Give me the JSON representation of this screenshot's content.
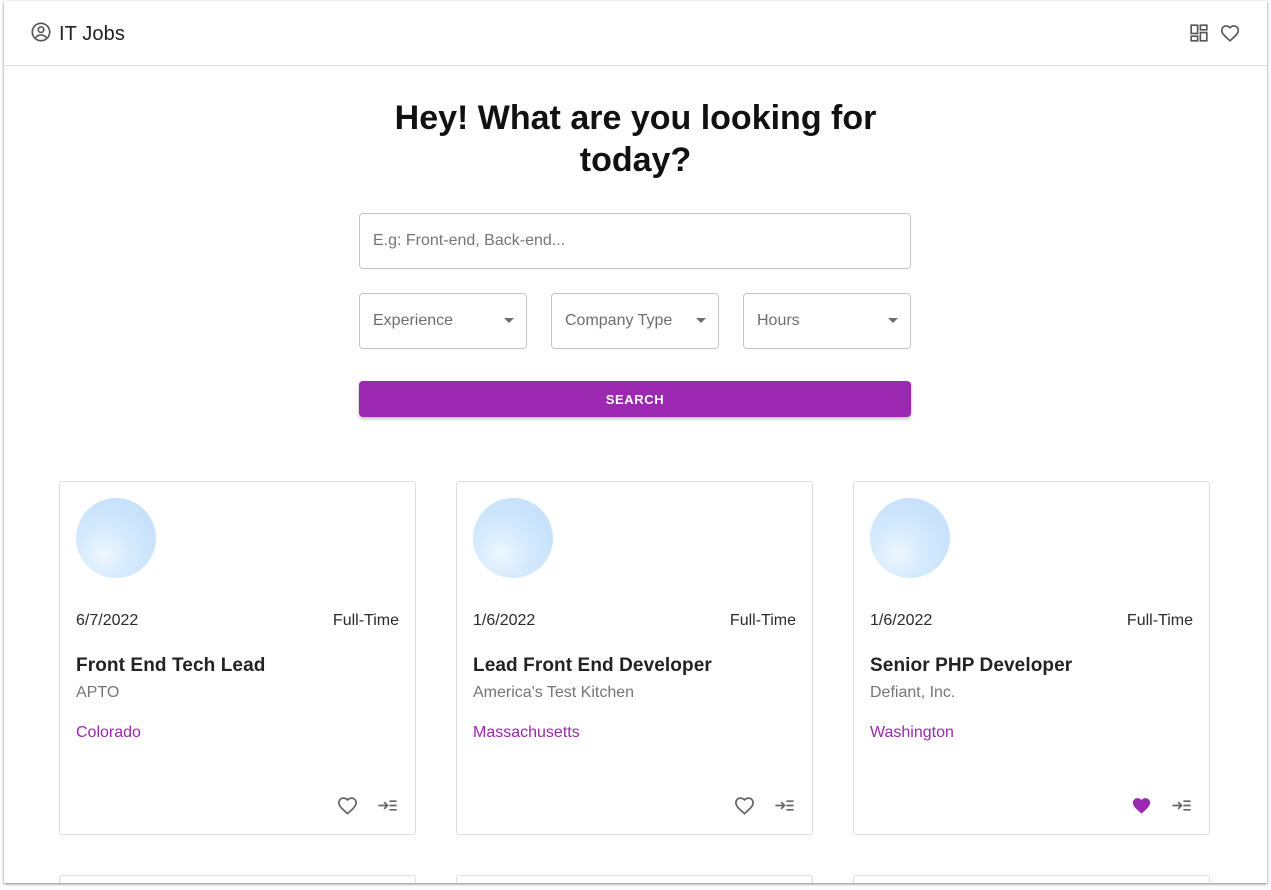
{
  "header": {
    "brand_icon": "account-circle-icon",
    "title": "IT Jobs",
    "actions": [
      {
        "name": "dashboard-icon"
      },
      {
        "name": "favorites-heart-icon"
      }
    ]
  },
  "hero": {
    "title_line1": "Hey! What are you looking for",
    "title_line2": "today?"
  },
  "search": {
    "placeholder": "E.g: Front-end, Back-end...",
    "value": ""
  },
  "filters": {
    "experience": "Experience",
    "company_type": "Company Type",
    "hours": "Hours"
  },
  "search_button": "SEARCH",
  "colors": {
    "accent": "#9c27b0",
    "muted": "#757575"
  },
  "jobs": [
    {
      "date": "6/7/2022",
      "type": "Full-Time",
      "title": "Front End Tech Lead",
      "company": "APTO",
      "location": "Colorado",
      "favorited": false
    },
    {
      "date": "1/6/2022",
      "type": "Full-Time",
      "title": "Lead Front End Developer",
      "company": "America's Test Kitchen",
      "location": "Massachusetts",
      "favorited": false
    },
    {
      "date": "1/6/2022",
      "type": "Full-Time",
      "title": "Senior PHP Developer",
      "company": "Defiant, Inc.",
      "location": "Washington",
      "favorited": true
    }
  ]
}
